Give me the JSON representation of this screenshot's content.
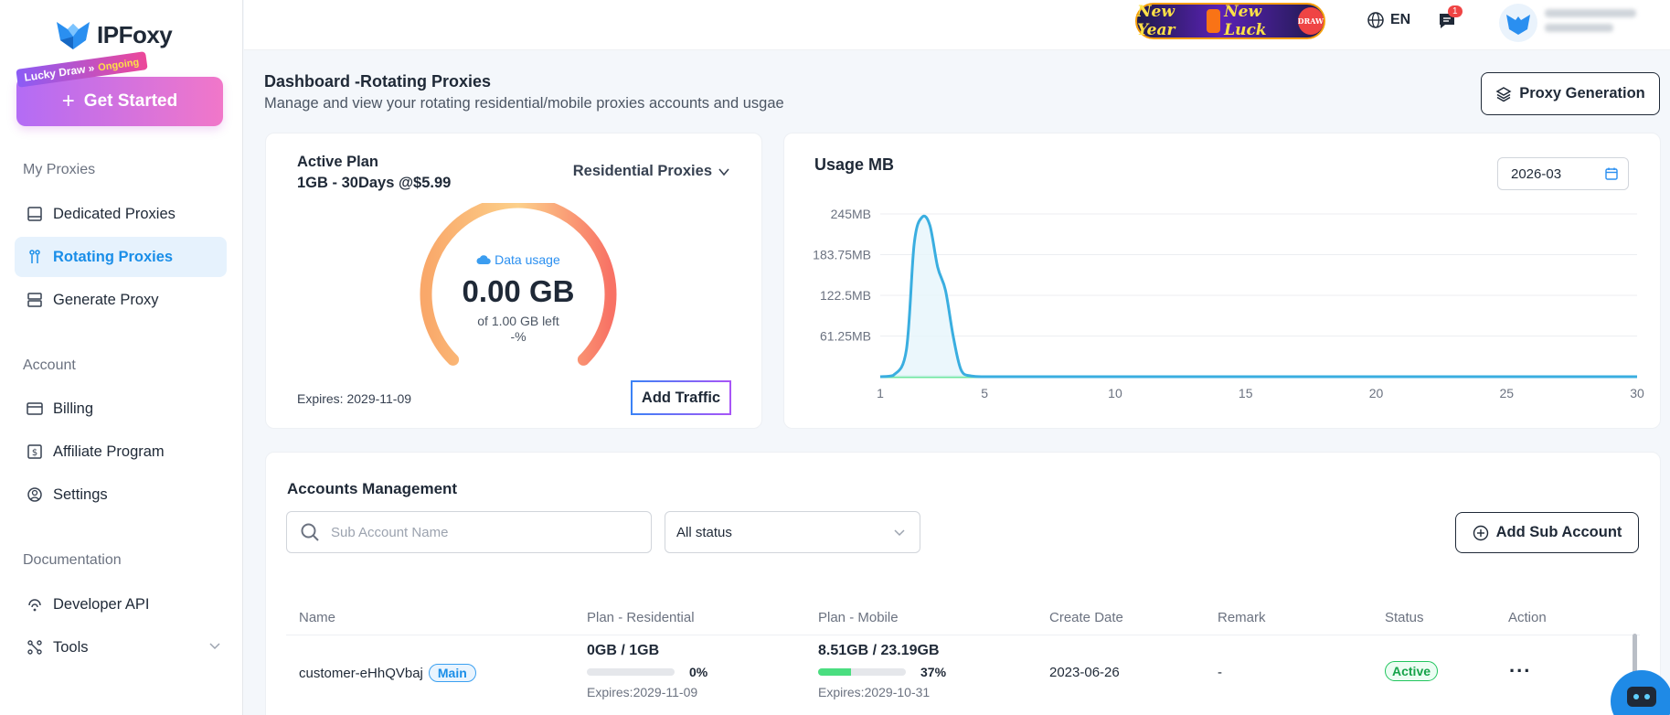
{
  "sidebar": {
    "logo_text": "IPFoxy",
    "lucky_tag": "Lucky Draw »",
    "lucky_ongoing": "Ongoing",
    "get_started": "Get Started",
    "sections": {
      "my_proxies": "My Proxies",
      "account": "Account",
      "documentation": "Documentation"
    },
    "items": {
      "dedicated": "Dedicated Proxies",
      "rotating": "Rotating Proxies",
      "generate": "Generate Proxy",
      "billing": "Billing",
      "affiliate": "Affiliate Program",
      "settings": "Settings",
      "developer_api": "Developer API",
      "tools": "Tools"
    }
  },
  "header": {
    "banner_text_1": "New Year",
    "banner_text_2": "New Luck",
    "banner_draw": "DRAW",
    "language": "EN",
    "message_count": "1"
  },
  "page": {
    "title": "Dashboard -Rotating Proxies",
    "subtitle": "Manage and view your rotating residential/mobile proxies accounts and usgae",
    "proxy_generation": "Proxy Generation"
  },
  "plan": {
    "label": "Active Plan",
    "description": "1GB - 30Days @$5.99",
    "type": "Residential Proxies",
    "data_usage_label": "Data usage",
    "data_value": "0.00 GB",
    "data_left": "of 1.00 GB left",
    "data_percent": "-%",
    "expires": "Expires: 2029-11-09",
    "add_traffic": "Add Traffic"
  },
  "usage": {
    "title": "Usage MB",
    "month": "2026-03"
  },
  "chart_data": {
    "type": "area",
    "title": "Usage MB",
    "xlabel": "",
    "ylabel": "",
    "x_ticks": [
      "1",
      "5",
      "10",
      "15",
      "20",
      "25",
      "30"
    ],
    "y_ticks": [
      "245MB",
      "183.75MB",
      "122.5MB",
      "61.25MB"
    ],
    "xlim": [
      1,
      30
    ],
    "ylim": [
      0,
      245
    ],
    "x": [
      1,
      1.5,
      2,
      2.3,
      2.6,
      2.9,
      3.2,
      3.5,
      3.8,
      4.1,
      4.5,
      5,
      6,
      8,
      10,
      15,
      20,
      25,
      30
    ],
    "y": [
      0,
      2,
      40,
      200,
      240,
      228,
      165,
      130,
      60,
      10,
      1,
      0,
      0,
      0,
      0,
      0,
      0,
      0,
      0
    ],
    "grid": true,
    "line_color": "#3aaee0"
  },
  "accounts": {
    "title": "Accounts Management",
    "search_placeholder": "Sub Account Name",
    "status_filter": "All status",
    "add_sub_account": "Add Sub Account",
    "columns": [
      "Name",
      "Plan - Residential",
      "Plan - Mobile",
      "Create Date",
      "Remark",
      "Status",
      "Action"
    ],
    "rows": [
      {
        "name": "customer-eHhQVbaj",
        "badge": "Main",
        "residential_usage": "0GB / 1GB",
        "residential_pct": "0%",
        "residential_fraction": 0,
        "residential_expires": "Expires:2029-11-09",
        "mobile_usage": "8.51GB / 23.19GB",
        "mobile_pct": "37%",
        "mobile_fraction": 0.37,
        "mobile_expires": "Expires:2029-10-31",
        "create_date": "2023-06-26",
        "remark": "-",
        "status": "Active",
        "action": "..."
      }
    ]
  },
  "colors": {
    "accent": "#1a8ee8",
    "active_nav_bg": "#e6f2fd",
    "success": "#22c55e"
  }
}
